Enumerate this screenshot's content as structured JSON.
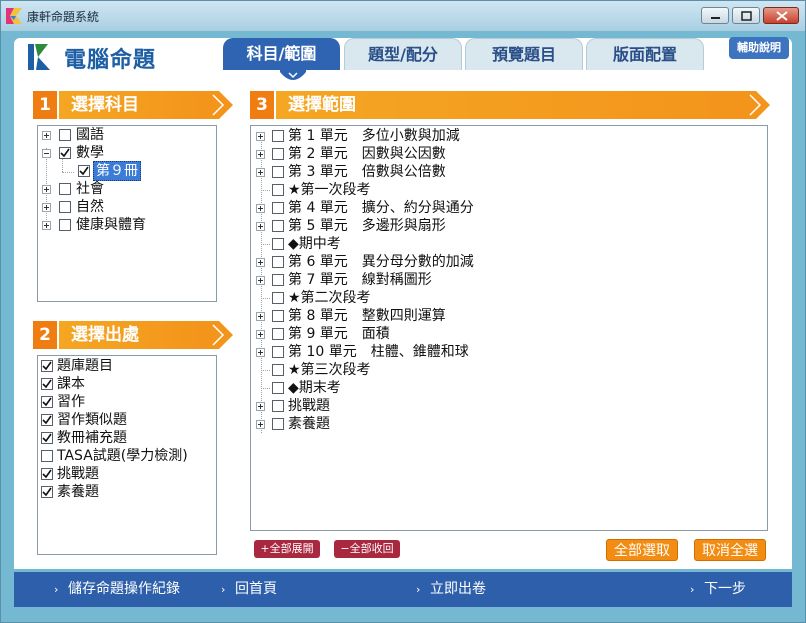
{
  "window": {
    "title": "康軒命題系統"
  },
  "app": {
    "logo_text": "電腦命題",
    "help_label": "輔助說明"
  },
  "tabs": [
    {
      "label": "科目/範圍",
      "active": true
    },
    {
      "label": "題型/配分",
      "active": false
    },
    {
      "label": "預覽題目",
      "active": false
    },
    {
      "label": "版面配置",
      "active": false
    }
  ],
  "subject": {
    "number": "1",
    "title": "選擇科目",
    "items": [
      {
        "label": "國語",
        "checked": false,
        "expanded": false
      },
      {
        "label": "數學",
        "checked": true,
        "expanded": true
      },
      {
        "label": "第９冊",
        "checked": true,
        "child": true,
        "selected": true
      },
      {
        "label": "社會",
        "checked": false,
        "expanded": false
      },
      {
        "label": "自然",
        "checked": false,
        "expanded": false
      },
      {
        "label": "健康與體育",
        "checked": false,
        "expanded": false
      }
    ]
  },
  "source": {
    "number": "2",
    "title": "選擇出處",
    "items": [
      {
        "label": "題庫題目",
        "checked": true
      },
      {
        "label": "課本",
        "checked": true
      },
      {
        "label": "習作",
        "checked": true
      },
      {
        "label": "習作類似題",
        "checked": true
      },
      {
        "label": "教冊補充題",
        "checked": true
      },
      {
        "label": "TASA試題(學力檢測)",
        "checked": false
      },
      {
        "label": "挑戰題",
        "checked": true
      },
      {
        "label": "素養題",
        "checked": true
      }
    ]
  },
  "scope": {
    "number": "3",
    "title": "選擇範圍",
    "items": [
      {
        "label": "第 1 單元　多位小數與加減",
        "expandable": true
      },
      {
        "label": "第 2 單元　因數與公因數",
        "expandable": true
      },
      {
        "label": "第 3 單元　倍數與公倍數",
        "expandable": true
      },
      {
        "label": "★第一次段考",
        "expandable": false
      },
      {
        "label": "第 4 單元　擴分、約分與通分",
        "expandable": true
      },
      {
        "label": "第 5 單元　多邊形與扇形",
        "expandable": true
      },
      {
        "label": "◆期中考",
        "expandable": false
      },
      {
        "label": "第 6 單元　異分母分數的加減",
        "expandable": true
      },
      {
        "label": "第 7 單元　線對稱圖形",
        "expandable": true
      },
      {
        "label": "★第二次段考",
        "expandable": false
      },
      {
        "label": "第 8 單元　整數四則運算",
        "expandable": true
      },
      {
        "label": "第 9 單元　面積",
        "expandable": true
      },
      {
        "label": "第 10 單元　柱體、錐體和球",
        "expandable": true
      },
      {
        "label": "★第三次段考",
        "expandable": false
      },
      {
        "label": "◆期末考",
        "expandable": false
      },
      {
        "label": "挑戰題",
        "expandable": true
      },
      {
        "label": "素養題",
        "expandable": true
      }
    ],
    "expand_all_label": "+全部展開",
    "collapse_all_label": "−全部收回",
    "select_all_label": "全部選取",
    "deselect_all_label": "取消全選"
  },
  "bottom_nav": {
    "save_log": "儲存命題操作紀錄",
    "home": "回首頁",
    "publish": "立即出卷",
    "next": "下一步"
  },
  "colors": {
    "frame": "#74b8d2",
    "tab_active": "#2e64b2",
    "section_orange": "#f5a623",
    "bottom_bar": "#2e5fab"
  }
}
